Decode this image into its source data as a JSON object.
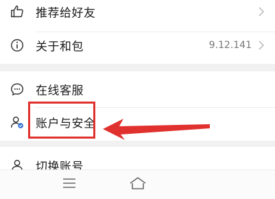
{
  "menu": {
    "recommend_label": "推荐给好友",
    "about_label": "关于和包",
    "version": "9.12.141",
    "service_label": "在线客服",
    "account_security_label": "账户与安全",
    "switch_account_label": "切换账号"
  },
  "icons": {
    "recommend": "thumbs-up-icon",
    "about": "info-icon",
    "service": "chat-icon",
    "account": "user-shield-icon",
    "switch": "user-icon",
    "menu": "menu-icon",
    "home": "home-icon"
  },
  "colors": {
    "annotation": "#e0312f"
  }
}
